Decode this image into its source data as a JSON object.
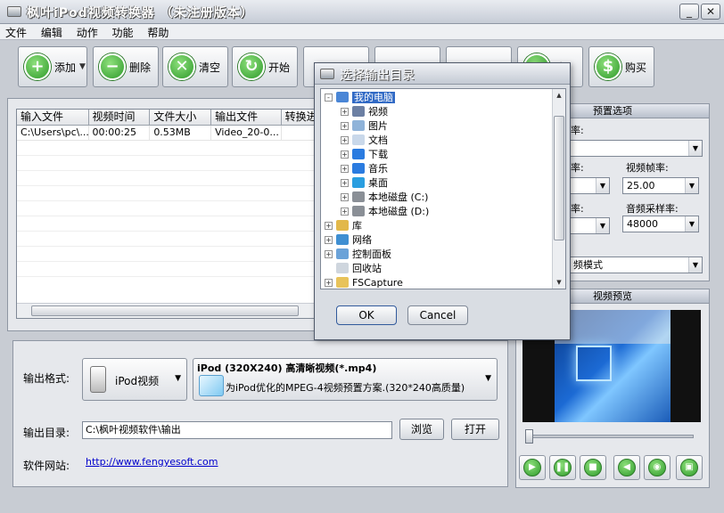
{
  "window": {
    "title": "枫叶iPod视频转换器  （未注册版本）",
    "minimize_glyph": "_",
    "close_glyph": "✕"
  },
  "menu": [
    "文件",
    "编辑",
    "动作",
    "功能",
    "帮助"
  ],
  "toolbar": {
    "add_label": "添加",
    "delete_label": "删除",
    "clear_label": "清空",
    "start_label": "开始",
    "buy_partial_label": "肤",
    "buy_label": "购买"
  },
  "file_list": {
    "columns": [
      "输入文件",
      "视频时间",
      "文件大小",
      "输出文件",
      "转换进"
    ],
    "rows": [
      {
        "input": "C:\\Users\\pc\\...",
        "duration": "00:00:25",
        "size": "0.53MB",
        "output": "Video_20-0..."
      }
    ]
  },
  "output": {
    "format_label": "输出格式:",
    "device": "iPod视频",
    "profile_title": "iPod (320X240) 高清晰视频(*.mp4)",
    "profile_desc": "为iPod优化的MPEG-4视频预置方案.(320*240高质量)",
    "dir_label": "输出目录:",
    "dir_value": "C:\\枫叶视频软件\\输出",
    "browse_label": "浏览",
    "open_label": "打开",
    "site_label": "软件网站:",
    "site_url": "http://www.fengyesoft.com"
  },
  "settings": {
    "header": "预置选项",
    "partial_label_1": "率:",
    "partial_label_2": "率:",
    "partial_label_3": "率:",
    "frame_rate_label": "视频帧率:",
    "frame_rate_value": "25.00",
    "sample_rate_label": "音频采样率:",
    "sample_rate_value": "48000",
    "mode_partial": "频模式"
  },
  "preview": {
    "header": "视频预览",
    "slider_position": 0
  },
  "dialog": {
    "title": "选择输出目录",
    "ok_label": "OK",
    "cancel_label": "Cancel",
    "tree": [
      {
        "label": "我的电脑",
        "level": 0,
        "exp": "-",
        "icon": "computer-icon",
        "selected": true
      },
      {
        "label": "视频",
        "level": 1,
        "exp": "+",
        "icon": "video-folder-icon"
      },
      {
        "label": "图片",
        "level": 1,
        "exp": "+",
        "icon": "pictures-folder-icon"
      },
      {
        "label": "文档",
        "level": 1,
        "exp": "+",
        "icon": "documents-folder-icon"
      },
      {
        "label": "下载",
        "level": 1,
        "exp": "+",
        "icon": "downloads-folder-icon"
      },
      {
        "label": "音乐",
        "level": 1,
        "exp": "+",
        "icon": "music-folder-icon"
      },
      {
        "label": "桌面",
        "level": 1,
        "exp": "+",
        "icon": "desktop-folder-icon"
      },
      {
        "label": "本地磁盘 (C:)",
        "level": 1,
        "exp": "+",
        "icon": "drive-icon"
      },
      {
        "label": "本地磁盘 (D:)",
        "level": 1,
        "exp": "+",
        "icon": "drive-icon"
      },
      {
        "label": "库",
        "level": 0,
        "exp": "+",
        "icon": "library-icon"
      },
      {
        "label": "网络",
        "level": 0,
        "exp": "+",
        "icon": "network-icon"
      },
      {
        "label": "控制面板",
        "level": 0,
        "exp": "+",
        "icon": "control-panel-icon"
      },
      {
        "label": "回收站",
        "level": 0,
        "exp": "",
        "icon": "recycle-bin-icon"
      },
      {
        "label": "FSCapture",
        "level": 0,
        "exp": "+",
        "icon": "folder-icon"
      }
    ]
  },
  "colors": {
    "selection": "#316ac5",
    "green_button": "#2e9a2a",
    "link": "#0000cc"
  }
}
